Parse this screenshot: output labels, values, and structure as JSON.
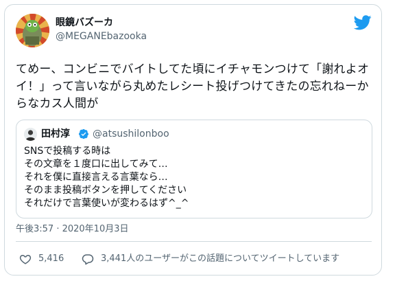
{
  "tweet": {
    "display_name": "眼鏡バズーカ",
    "handle": "@MEGANEbazooka",
    "text": "てめー、コンビニでバイトしてた頃にイチャモンつけて「謝れよオイ！」って言いながら丸めたレシート投げつけてきたの忘れねーからなカス人間が",
    "timestamp": "午後3:57 · 2020年10月3日",
    "like_count": "5,416",
    "conversation_label": "3,441人のユーザーがこの話題についてツイートしています"
  },
  "quoted_tweet": {
    "display_name": "田村淳",
    "handle": "@atsushilonboo",
    "text": "SNSで投稿する時は\nその文章を１度口に出してみて…\nそれを僕に直接言える言葉なら…\nそのまま投稿ボタンを押してください\nそれだけで言葉使いが変わるはず^_^"
  },
  "icons": {
    "brand": "twitter-bird-icon",
    "verified": "verified-badge-icon",
    "like": "heart-icon",
    "reply": "reply-bubble-icon"
  },
  "colors": {
    "brand_blue": "#1d9bf0",
    "text": "#0f1419",
    "secondary_text": "#536471",
    "border": "#cfd9de"
  }
}
